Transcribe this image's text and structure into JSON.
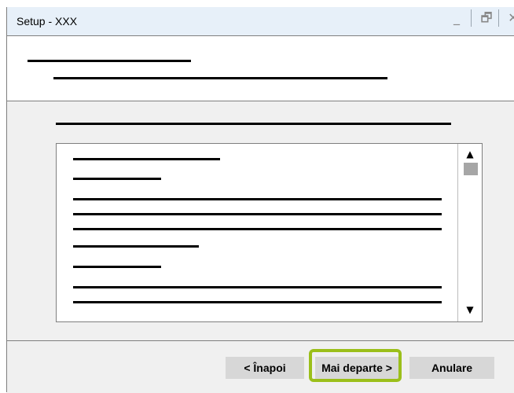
{
  "window": {
    "title": "Setup - XXX",
    "minimize_icon": "minimize-icon",
    "maximize_icon": "restore-icon",
    "close_icon": "close-icon",
    "minimize_glyph": "_",
    "maximize_glyph": "🗗",
    "close_glyph": "✕"
  },
  "scrollbar": {
    "up_icon": "scroll-up-arrow",
    "down_icon": "scroll-down-arrow",
    "up_glyph": "▲",
    "down_glyph": "▼"
  },
  "footer": {
    "back_label": "< Înapoi",
    "next_label": "Mai departe >",
    "cancel_label": "Anulare"
  },
  "colors": {
    "titlebar_bg": "#e7f0f9",
    "panel_bg": "#f0f0f0",
    "button_bg": "#d7d7d7",
    "highlight": "#9bbf1a"
  }
}
